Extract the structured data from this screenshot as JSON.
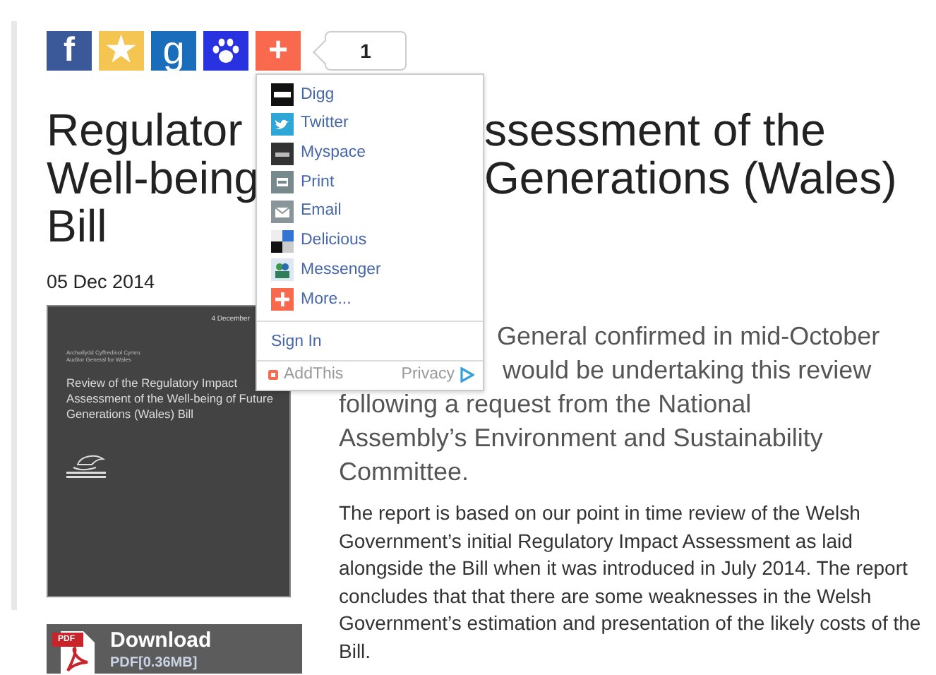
{
  "share_buttons": [
    {
      "kind": "glyph",
      "glyph": "f",
      "color": "#3b5998"
    },
    {
      "kind": "glyph",
      "glyph": "★",
      "color": "#f5c551"
    },
    {
      "kind": "glyph",
      "glyph": "g",
      "color": "#1a6dbb"
    },
    {
      "kind": "paw",
      "color": "#2932e1"
    },
    {
      "kind": "glyph",
      "glyph": "+",
      "color": "#f8694d"
    }
  ],
  "share_count": "1",
  "share_menu": {
    "items": [
      {
        "label": "Digg"
      },
      {
        "label": "Twitter"
      },
      {
        "label": "Myspace"
      },
      {
        "label": "Print"
      },
      {
        "label": "Email"
      },
      {
        "label": "Delicious"
      },
      {
        "label": "Messenger"
      },
      {
        "label": "More..."
      }
    ],
    "sign_in": "Sign In",
    "brand": "AddThis",
    "privacy": "Privacy"
  },
  "title_lines": [
    {
      "left": "Regulator",
      "right": "ssessment of the"
    },
    {
      "left": "Well-being",
      "right": "Generations (Wales)"
    },
    {
      "left": "Bill"
    }
  ],
  "date": "05 Dec 2014",
  "cover": {
    "date": "4 December",
    "publisher_lines": [
      "Archwilydd Cyffredinol Cymru",
      "Auditor General for Wales"
    ],
    "title": "Review of the Regulatory Impact Assessment of the Well-being of Future Generations (Wales) Bill"
  },
  "lead_lines": [
    "General confirmed in mid-October",
    "would be undertaking this review",
    "following a request from the National",
    "Assembly’s Environment and Sustainability",
    "Committee."
  ],
  "body": "The report is based on our point in time review of the Welsh Government’s initial Regulatory Impact Assessment as laid alongside the Bill when it was introduced in July 2014. The report concludes that that there are some weaknesses in the Welsh Government’s estimation and presentation of the likely costs of the Bill.",
  "download": {
    "label": "Download",
    "file": "PDF[0.36MB]",
    "badge": "PDF"
  }
}
